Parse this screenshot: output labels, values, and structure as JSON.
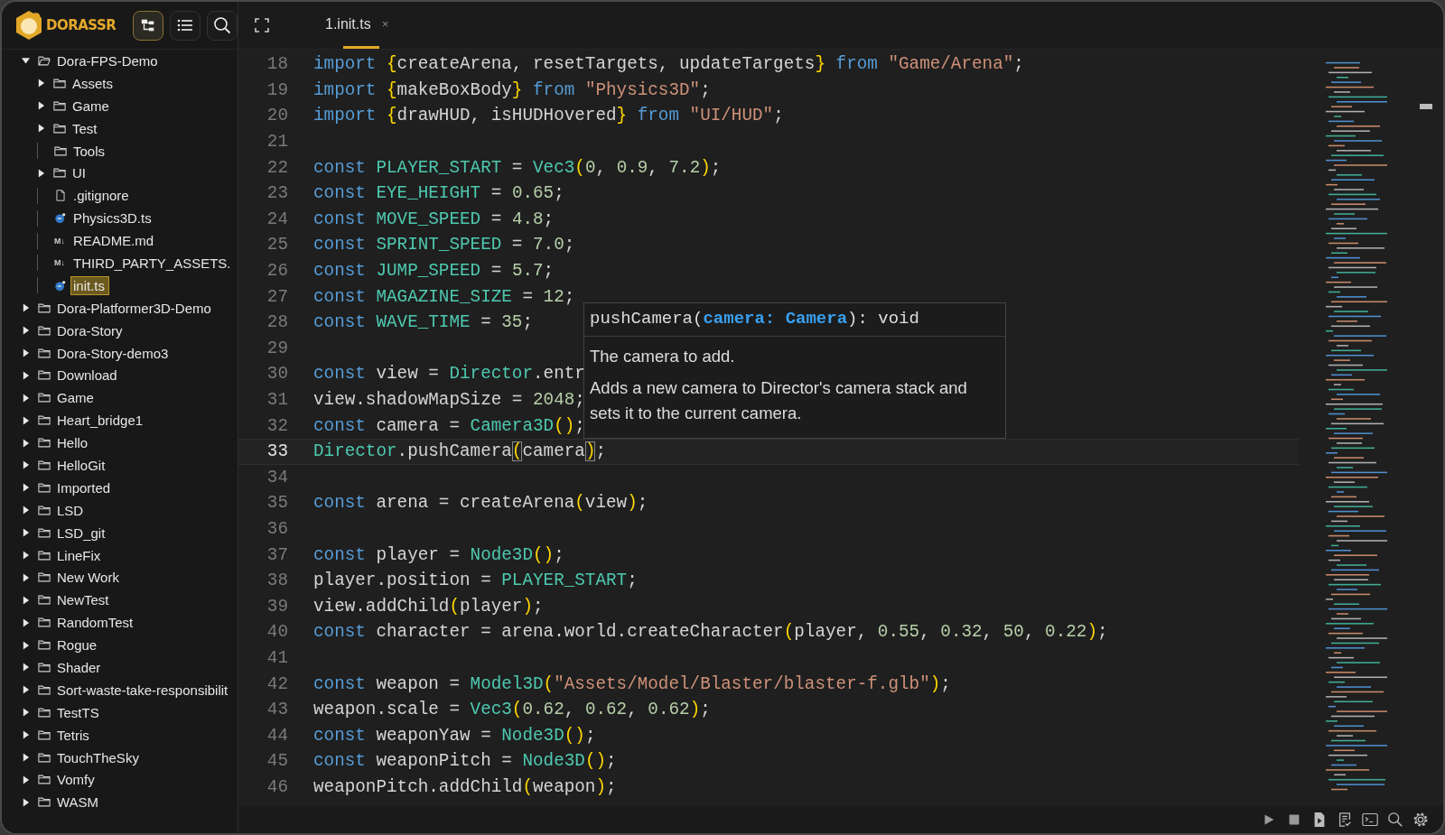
{
  "brand": {
    "name": "DORASSR"
  },
  "toolbar": [
    {
      "kind": "tree",
      "selected": true
    },
    {
      "kind": "list",
      "selected": false
    },
    {
      "kind": "search",
      "selected": false
    }
  ],
  "tree": [
    {
      "kind": "folder",
      "label": "Dora-FPS-Demo",
      "expanded": true,
      "selected": false,
      "children": [
        {
          "kind": "folder",
          "label": "Assets",
          "expanded": false,
          "selected": false
        },
        {
          "kind": "folder",
          "label": "Game",
          "expanded": false,
          "selected": false
        },
        {
          "kind": "folder",
          "label": "Test",
          "expanded": false,
          "selected": false
        },
        {
          "kind": "empty-folder",
          "label": "Tools",
          "selected": false
        },
        {
          "kind": "folder",
          "label": "UI",
          "expanded": false,
          "selected": false
        },
        {
          "kind": "file",
          "label": ".gitignore",
          "selected": false
        },
        {
          "kind": "ts",
          "label": "Physics3D.ts",
          "selected": false
        },
        {
          "kind": "md",
          "badge": "M↓",
          "label": "README.md",
          "selected": false
        },
        {
          "kind": "md",
          "badge": "M↓",
          "label": "THIRD_PARTY_ASSETS.",
          "selected": false
        },
        {
          "kind": "ts",
          "label": "init.ts",
          "selected": true
        }
      ]
    },
    {
      "kind": "folder",
      "label": "Dora-Platformer3D-Demo",
      "expanded": false,
      "selected": false
    },
    {
      "kind": "folder",
      "label": "Dora-Story",
      "expanded": false,
      "selected": false
    },
    {
      "kind": "folder",
      "label": "Dora-Story-demo3",
      "expanded": false,
      "selected": false
    },
    {
      "kind": "folder",
      "label": "Download",
      "expanded": false,
      "selected": false
    },
    {
      "kind": "folder",
      "label": "Game",
      "expanded": false,
      "selected": false
    },
    {
      "kind": "folder",
      "label": "Heart_bridge1",
      "expanded": false,
      "selected": false
    },
    {
      "kind": "folder",
      "label": "Hello",
      "expanded": false,
      "selected": false
    },
    {
      "kind": "folder",
      "label": "HelloGit",
      "expanded": false,
      "selected": false
    },
    {
      "kind": "folder",
      "label": "Imported",
      "expanded": false,
      "selected": false
    },
    {
      "kind": "folder",
      "label": "LSD",
      "expanded": false,
      "selected": false
    },
    {
      "kind": "folder",
      "label": "LSD_git",
      "expanded": false,
      "selected": false
    },
    {
      "kind": "folder",
      "label": "LineFix",
      "expanded": false,
      "selected": false
    },
    {
      "kind": "folder",
      "label": "New Work",
      "expanded": false,
      "selected": false
    },
    {
      "kind": "folder",
      "label": "NewTest",
      "expanded": false,
      "selected": false
    },
    {
      "kind": "folder",
      "label": "RandomTest",
      "expanded": false,
      "selected": false
    },
    {
      "kind": "folder",
      "label": "Rogue",
      "expanded": false,
      "selected": false
    },
    {
      "kind": "folder",
      "label": "Shader",
      "expanded": false,
      "selected": false
    },
    {
      "kind": "folder",
      "label": "Sort-waste-take-responsibilit",
      "expanded": false,
      "selected": false
    },
    {
      "kind": "folder",
      "label": "TestTS",
      "expanded": false,
      "selected": false
    },
    {
      "kind": "folder",
      "label": "Tetris",
      "expanded": false,
      "selected": false
    },
    {
      "kind": "folder",
      "label": "TouchTheSky",
      "expanded": false,
      "selected": false
    },
    {
      "kind": "folder",
      "label": "Vomfy",
      "expanded": false,
      "selected": false
    },
    {
      "kind": "folder",
      "label": "WASM",
      "expanded": false,
      "selected": false
    }
  ],
  "tabs": [
    {
      "label": "1.init.ts",
      "close": "×",
      "selected": true
    }
  ],
  "code": [
    {
      "number": "18",
      "tokens": [
        {
          "kind": "kw",
          "text": "import "
        },
        {
          "kind": "br",
          "text": "{"
        },
        {
          "kind": "pl",
          "text": "createArena, resetTargets, updateTargets"
        },
        {
          "kind": "br",
          "text": "} "
        },
        {
          "kind": "kw",
          "text": "from "
        },
        {
          "kind": "str",
          "text": "\"Game/Arena\""
        },
        {
          "kind": "pl",
          "text": ";"
        }
      ]
    },
    {
      "number": "19",
      "tokens": [
        {
          "kind": "kw",
          "text": "import "
        },
        {
          "kind": "br",
          "text": "{"
        },
        {
          "kind": "pl",
          "text": "makeBoxBody"
        },
        {
          "kind": "br",
          "text": "} "
        },
        {
          "kind": "kw",
          "text": "from "
        },
        {
          "kind": "str",
          "text": "\"Physics3D\""
        },
        {
          "kind": "pl",
          "text": ";"
        }
      ]
    },
    {
      "number": "20",
      "tokens": [
        {
          "kind": "kw",
          "text": "import "
        },
        {
          "kind": "br",
          "text": "{"
        },
        {
          "kind": "pl",
          "text": "drawHUD, isHUDHovered"
        },
        {
          "kind": "br",
          "text": "} "
        },
        {
          "kind": "kw",
          "text": "from "
        },
        {
          "kind": "str",
          "text": "\"UI/HUD\""
        },
        {
          "kind": "pl",
          "text": ";"
        }
      ]
    },
    {
      "number": "21"
    },
    {
      "number": "22",
      "tokens": [
        {
          "kind": "kw",
          "text": "const "
        },
        {
          "kind": "cn",
          "text": "PLAYER_START"
        },
        {
          "kind": "pl",
          "text": " = "
        },
        {
          "kind": "cn",
          "text": "Vec3"
        },
        {
          "kind": "br",
          "text": "("
        },
        {
          "kind": "num",
          "text": "0"
        },
        {
          "kind": "pl",
          "text": ", "
        },
        {
          "kind": "num",
          "text": "0.9"
        },
        {
          "kind": "pl",
          "text": ", "
        },
        {
          "kind": "num",
          "text": "7.2"
        },
        {
          "kind": "br",
          "text": ")"
        },
        {
          "kind": "pl",
          "text": ";"
        }
      ]
    },
    {
      "number": "23",
      "tokens": [
        {
          "kind": "kw",
          "text": "const "
        },
        {
          "kind": "cn",
          "text": "EYE_HEIGHT"
        },
        {
          "kind": "pl",
          "text": " = "
        },
        {
          "kind": "num",
          "text": "0.65"
        },
        {
          "kind": "pl",
          "text": ";"
        }
      ]
    },
    {
      "number": "24",
      "tokens": [
        {
          "kind": "kw",
          "text": "const "
        },
        {
          "kind": "cn",
          "text": "MOVE_SPEED"
        },
        {
          "kind": "pl",
          "text": " = "
        },
        {
          "kind": "num",
          "text": "4.8"
        },
        {
          "kind": "pl",
          "text": ";"
        }
      ]
    },
    {
      "number": "25",
      "tokens": [
        {
          "kind": "kw",
          "text": "const "
        },
        {
          "kind": "cn",
          "text": "SPRINT_SPEED"
        },
        {
          "kind": "pl",
          "text": " = "
        },
        {
          "kind": "num",
          "text": "7.0"
        },
        {
          "kind": "pl",
          "text": ";"
        }
      ]
    },
    {
      "number": "26",
      "tokens": [
        {
          "kind": "kw",
          "text": "const "
        },
        {
          "kind": "cn",
          "text": "JUMP_SPEED"
        },
        {
          "kind": "pl",
          "text": " = "
        },
        {
          "kind": "num",
          "text": "5.7"
        },
        {
          "kind": "pl",
          "text": ";"
        }
      ]
    },
    {
      "number": "27",
      "tokens": [
        {
          "kind": "kw",
          "text": "const "
        },
        {
          "kind": "cn",
          "text": "MAGAZINE_SIZE"
        },
        {
          "kind": "pl",
          "text": " = "
        },
        {
          "kind": "num",
          "text": "12"
        },
        {
          "kind": "pl",
          "text": ";"
        }
      ]
    },
    {
      "number": "28",
      "tokens": [
        {
          "kind": "kw",
          "text": "const "
        },
        {
          "kind": "cn",
          "text": "WAVE_TIME"
        },
        {
          "kind": "pl",
          "text": " = "
        },
        {
          "kind": "num",
          "text": "35"
        },
        {
          "kind": "pl",
          "text": ";"
        }
      ]
    },
    {
      "number": "29"
    },
    {
      "number": "30",
      "tokens": [
        {
          "kind": "kw",
          "text": "const "
        },
        {
          "kind": "pl",
          "text": "view = "
        },
        {
          "kind": "cn",
          "text": "Director"
        },
        {
          "kind": "pl",
          "text": ".entr"
        }
      ]
    },
    {
      "number": "31",
      "tokens": [
        {
          "kind": "pl",
          "text": "view.shadowMapSize = "
        },
        {
          "kind": "num",
          "text": "2048"
        },
        {
          "kind": "pl",
          "text": ";"
        }
      ]
    },
    {
      "number": "32",
      "tokens": [
        {
          "kind": "kw",
          "text": "const "
        },
        {
          "kind": "pl",
          "text": "camera = "
        },
        {
          "kind": "cn",
          "text": "Camera3D"
        },
        {
          "kind": "br",
          "text": "()"
        },
        {
          "kind": "pl",
          "text": ";"
        }
      ]
    },
    {
      "number": "33",
      "current": true,
      "tokens": [
        {
          "kind": "cn",
          "text": "Director"
        },
        {
          "kind": "pl",
          "text": ".pushCamera"
        },
        {
          "kind": "match",
          "text": "("
        },
        {
          "kind": "pl",
          "text": "camera"
        },
        {
          "kind": "match",
          "text": ")"
        },
        {
          "kind": "pl",
          "text": ";"
        }
      ]
    },
    {
      "number": "34"
    },
    {
      "number": "35",
      "tokens": [
        {
          "kind": "kw",
          "text": "const "
        },
        {
          "kind": "pl",
          "text": "arena = createArena"
        },
        {
          "kind": "br",
          "text": "("
        },
        {
          "kind": "pl",
          "text": "view"
        },
        {
          "kind": "br",
          "text": ")"
        },
        {
          "kind": "pl",
          "text": ";"
        }
      ]
    },
    {
      "number": "36"
    },
    {
      "number": "37",
      "tokens": [
        {
          "kind": "kw",
          "text": "const "
        },
        {
          "kind": "pl",
          "text": "player = "
        },
        {
          "kind": "cn",
          "text": "Node3D"
        },
        {
          "kind": "br",
          "text": "()"
        },
        {
          "kind": "pl",
          "text": ";"
        }
      ]
    },
    {
      "number": "38",
      "tokens": [
        {
          "kind": "pl",
          "text": "player.position = "
        },
        {
          "kind": "cn",
          "text": "PLAYER_START"
        },
        {
          "kind": "pl",
          "text": ";"
        }
      ]
    },
    {
      "number": "39",
      "tokens": [
        {
          "kind": "pl",
          "text": "view.addChild"
        },
        {
          "kind": "br",
          "text": "("
        },
        {
          "kind": "pl",
          "text": "player"
        },
        {
          "kind": "br",
          "text": ")"
        },
        {
          "kind": "pl",
          "text": ";"
        }
      ]
    },
    {
      "number": "40",
      "tokens": [
        {
          "kind": "kw",
          "text": "const "
        },
        {
          "kind": "pl",
          "text": "character = arena.world.createCharacter"
        },
        {
          "kind": "br",
          "text": "("
        },
        {
          "kind": "pl",
          "text": "player, "
        },
        {
          "kind": "num",
          "text": "0.55"
        },
        {
          "kind": "pl",
          "text": ", "
        },
        {
          "kind": "num",
          "text": "0.32"
        },
        {
          "kind": "pl",
          "text": ", "
        },
        {
          "kind": "num",
          "text": "50"
        },
        {
          "kind": "pl",
          "text": ", "
        },
        {
          "kind": "num",
          "text": "0.22"
        },
        {
          "kind": "br",
          "text": ")"
        },
        {
          "kind": "pl",
          "text": ";"
        }
      ]
    },
    {
      "number": "41"
    },
    {
      "number": "42",
      "tokens": [
        {
          "kind": "kw",
          "text": "const "
        },
        {
          "kind": "pl",
          "text": "weapon = "
        },
        {
          "kind": "cn",
          "text": "Model3D"
        },
        {
          "kind": "br",
          "text": "("
        },
        {
          "kind": "str",
          "text": "\"Assets/Model/Blaster/blaster-f.glb\""
        },
        {
          "kind": "br",
          "text": ")"
        },
        {
          "kind": "pl",
          "text": ";"
        }
      ]
    },
    {
      "number": "43",
      "tokens": [
        {
          "kind": "pl",
          "text": "weapon.scale = "
        },
        {
          "kind": "cn",
          "text": "Vec3"
        },
        {
          "kind": "br",
          "text": "("
        },
        {
          "kind": "num",
          "text": "0.62"
        },
        {
          "kind": "pl",
          "text": ", "
        },
        {
          "kind": "num",
          "text": "0.62"
        },
        {
          "kind": "pl",
          "text": ", "
        },
        {
          "kind": "num",
          "text": "0.62"
        },
        {
          "kind": "br",
          "text": ")"
        },
        {
          "kind": "pl",
          "text": ";"
        }
      ]
    },
    {
      "number": "44",
      "tokens": [
        {
          "kind": "kw",
          "text": "const "
        },
        {
          "kind": "pl",
          "text": "weaponYaw = "
        },
        {
          "kind": "cn",
          "text": "Node3D"
        },
        {
          "kind": "br",
          "text": "()"
        },
        {
          "kind": "pl",
          "text": ";"
        }
      ]
    },
    {
      "number": "45",
      "tokens": [
        {
          "kind": "kw",
          "text": "const "
        },
        {
          "kind": "pl",
          "text": "weaponPitch = "
        },
        {
          "kind": "cn",
          "text": "Node3D"
        },
        {
          "kind": "br",
          "text": "()"
        },
        {
          "kind": "pl",
          "text": ";"
        }
      ]
    },
    {
      "number": "46",
      "tokens": [
        {
          "kind": "pl",
          "text": "weaponPitch.addChild"
        },
        {
          "kind": "br",
          "text": "("
        },
        {
          "kind": "pl",
          "text": "weapon"
        },
        {
          "kind": "br",
          "text": ")"
        },
        {
          "kind": "pl",
          "text": ";"
        }
      ]
    }
  ],
  "tooltip": {
    "signature": "pushCamera(**camera: Camera**): void",
    "param": "The camera to add.",
    "description": "Adds a new camera to Director's camera stack and sets it to the current camera."
  },
  "bottom_toolbar": [
    {
      "kind": "play"
    },
    {
      "kind": "stop"
    },
    {
      "kind": "run-file"
    },
    {
      "kind": "checklist"
    },
    {
      "kind": "terminal"
    },
    {
      "kind": "search"
    },
    {
      "kind": "settings"
    }
  ]
}
